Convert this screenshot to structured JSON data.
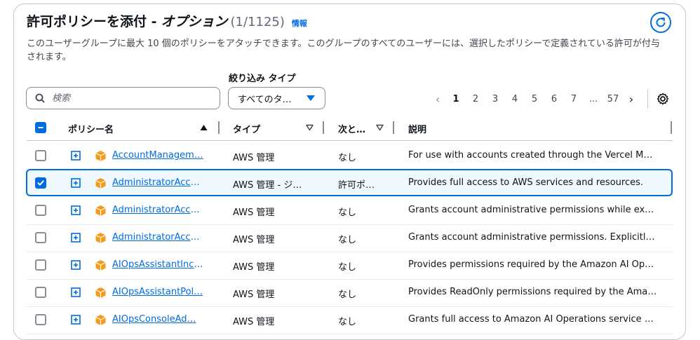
{
  "header": {
    "title": "許可ポリシーを添付 -",
    "title_em": "オプション",
    "count": "(1/1125)",
    "info_link": "情報"
  },
  "description": "このユーザーグループに最大 10 個のポリシーをアタッチできます。このグループのすべてのユーザーには、選択したポリシーで定義されている許可が付与されます。",
  "filter": {
    "label": "絞り込み タイプ",
    "search_placeholder": "検索",
    "type_value": "すべてのタ…"
  },
  "pagination": {
    "pages": [
      "1",
      "2",
      "3",
      "4",
      "5",
      "6",
      "7",
      "...",
      "57"
    ],
    "current": "1"
  },
  "table": {
    "columns": [
      "ポリシー名",
      "タイプ",
      "次と…",
      "説明"
    ],
    "rows": [
      {
        "name": "AccountManagem…",
        "type": "AWS 管理",
        "used": "なし",
        "desc": "For use with accounts created through the Vercel Mar…",
        "checked": false
      },
      {
        "name": "AdministratorAccess",
        "type": "AWS 管理 - ジ…",
        "used": "許可ポ…",
        "desc": "Provides full access to AWS services and resources.",
        "checked": true
      },
      {
        "name": "AdministratorAcce…",
        "type": "AWS 管理",
        "used": "なし",
        "desc": "Grants account administrative permissions while expli…",
        "checked": false
      },
      {
        "name": "AdministratorAcce…",
        "type": "AWS 管理",
        "used": "なし",
        "desc": "Grants account administrative permissions. Explicitly …",
        "checked": false
      },
      {
        "name": "AIOpsAssistantInci…",
        "type": "AWS 管理",
        "used": "なし",
        "desc": "Provides permissions required by the Amazon AI Oper…",
        "checked": false
      },
      {
        "name": "AIOpsAssistantPol…",
        "type": "AWS 管理",
        "used": "なし",
        "desc": "Provides ReadOnly permissions required by the Amaz…",
        "checked": false
      },
      {
        "name": "AIOpsConsoleAd…",
        "type": "AWS 管理",
        "used": "なし",
        "desc": "Grants full access to Amazon AI Operations service an…",
        "checked": false
      }
    ]
  },
  "colors": {
    "accent": "#006ce0",
    "cube": "#f59b1c",
    "border": "#c6c6cd"
  }
}
